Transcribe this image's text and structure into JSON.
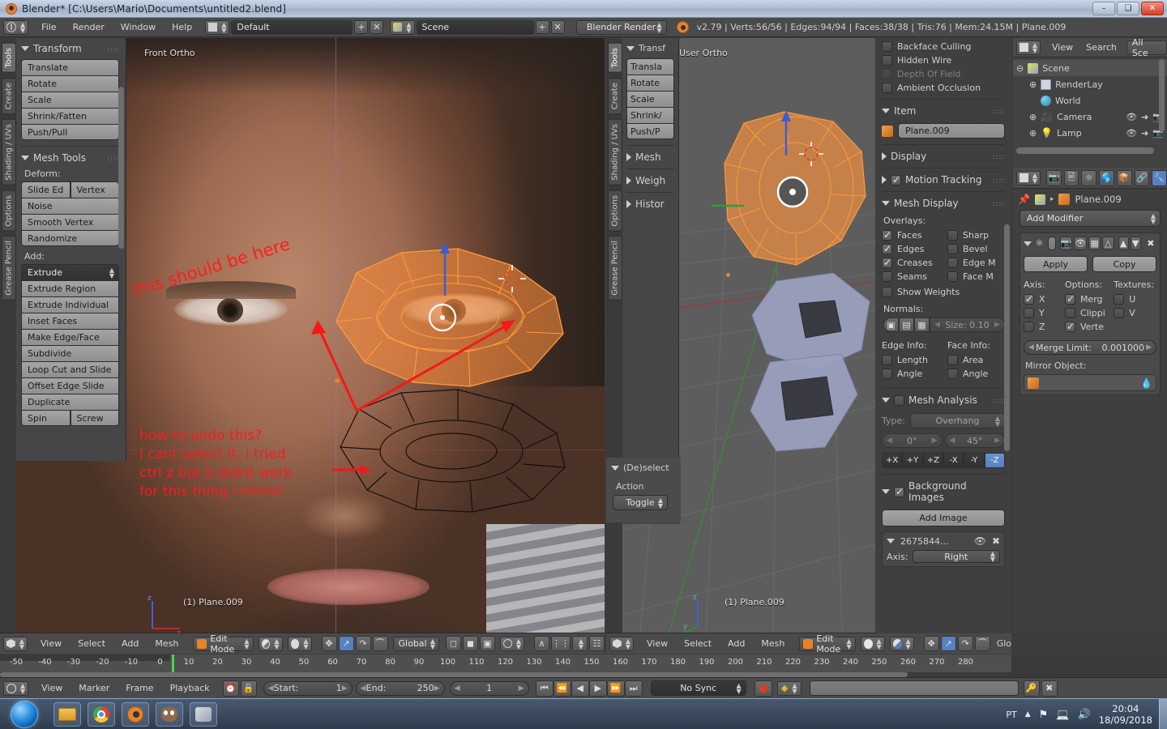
{
  "window": {
    "title": "Blender* [C:\\Users\\Mario\\Documents\\untitled2.blend]",
    "minimize": "–",
    "maximize": "❑",
    "close": "✕"
  },
  "topbar": {
    "info_icon": "info-icon",
    "menus": [
      "File",
      "Render",
      "Window",
      "Help"
    ],
    "screen_layout": "Default",
    "add_layout": "+",
    "remove_layout": "✕",
    "scene": "Scene",
    "add_scene": "+",
    "remove_scene": "✕",
    "engine": "Blender Render",
    "stats": "v2.79 | Verts:56/56 | Edges:94/94 | Faces:38/38 | Tris:76 | Mem:24.15M | Plane.009"
  },
  "viewport_left": {
    "view_label": "Front Ortho",
    "object_label": "(1) Plane.009",
    "vtabs": [
      "Tools",
      "Create",
      "Shading / UVs",
      "Options",
      "Grease Pencil"
    ],
    "active_vtab": "Tools",
    "transform": {
      "title": "Transform",
      "buttons": [
        "Translate",
        "Rotate",
        "Scale",
        "Shrink/Fatten",
        "Push/Pull"
      ]
    },
    "mesh_tools": {
      "title": "Mesh Tools",
      "deform_label": "Deform:",
      "deform_row": [
        "Slide Ed",
        "Vertex"
      ],
      "deform_buttons": [
        "Noise",
        "Smooth Vertex",
        "Randomize"
      ],
      "add_label": "Add:",
      "add_dropdown": "Extrude",
      "add_buttons": [
        "Extrude Region",
        "Extrude Individual",
        "Inset Faces",
        "Make Edge/Face",
        "Subdivide",
        "Loop Cut and Slide",
        "Offset Edge Slide",
        "Duplicate"
      ],
      "last_row": [
        "Spin",
        "Screw"
      ]
    },
    "header": {
      "editor_icon": "editor-type-icon",
      "menus": [
        "View",
        "Select",
        "Add",
        "Mesh"
      ],
      "mode": "Edit Mode",
      "mode_icon": "edit-mode-icon",
      "shading_icon": "viewport-shading-icon",
      "select_modes": [
        "vertex-select-icon",
        "edge-select-icon",
        "face-select-icon"
      ],
      "pivot_icon": "pivot-point-icon",
      "manipulator_icons": [
        "translate-manipulator-icon",
        "rotate-manipulator-icon",
        "scale-manipulator-icon"
      ],
      "orientation": "Global",
      "layer_icons": [
        "limit-to-visible-icon",
        "xray-icon",
        "occlude-icon"
      ],
      "proportional_icon": "proportional-editing-icon",
      "snap_icon": "snap-magnet-icon",
      "snap_target_icon": "snap-target-icon",
      "pivot_center_icon": "pivot-center-icon"
    },
    "annotations": {
      "one": "this should be here",
      "two": "how to undo this?\ni cant select it, i tried\nctrl z but it didnt work\nfor this thing i mirror"
    }
  },
  "viewport_right": {
    "view_label": "User Ortho",
    "object_label": "(1) Plane.009",
    "vtabs": [
      "Tools",
      "Create",
      "Shading / UVs",
      "Options",
      "Grease Pencil"
    ],
    "transform": {
      "title": "Transf",
      "buttons": [
        "Transla",
        "Rotate",
        "Scale",
        "Shrink/",
        "Push/P"
      ]
    },
    "collapsed_panels": [
      "Mesh",
      "Weigh",
      "Histor"
    ],
    "deselect_panel": {
      "title": "(De)select",
      "action_label": "Action",
      "action_value": "Toggle"
    },
    "header": {
      "menus": [
        "View",
        "Select",
        "Add",
        "Mesh"
      ],
      "mode": "Edit Mode",
      "orientation": "Glo"
    }
  },
  "npanel": {
    "display_checks": [
      {
        "label": "Backface Culling",
        "checked": false,
        "disabled": false
      },
      {
        "label": "Hidden Wire",
        "checked": false,
        "disabled": false
      },
      {
        "label": "Depth Of Field",
        "checked": false,
        "disabled": true
      },
      {
        "label": "Ambient Occlusion",
        "checked": false,
        "disabled": false
      }
    ],
    "item": {
      "title": "Item",
      "object_icon": "object-data-icon",
      "name": "Plane.009"
    },
    "display": {
      "title": "Display"
    },
    "motion_tracking": {
      "title": "Motion Tracking",
      "checked": true
    },
    "mesh_display": {
      "title": "Mesh Display",
      "overlays_label": "Overlays:",
      "left_column": [
        {
          "label": "Faces",
          "checked": true
        },
        {
          "label": "Edges",
          "checked": true
        },
        {
          "label": "Creases",
          "checked": true
        },
        {
          "label": "Seams",
          "checked": false
        },
        {
          "label": "Show Weights",
          "checked": false
        }
      ],
      "right_column": [
        {
          "label": "Sharp",
          "checked": false
        },
        {
          "label": "Bevel",
          "checked": false
        },
        {
          "label": "Edge M",
          "checked": false
        },
        {
          "label": "Face M",
          "checked": false
        }
      ],
      "normals_label": "Normals:",
      "normals_icons": [
        "vertex-normal-icon",
        "split-normal-icon",
        "face-normal-icon"
      ],
      "normals_size": "Size: 0.10",
      "edge_info_label": "Edge Info:",
      "face_info_label": "Face Info:",
      "edge_info": [
        {
          "label": "Length",
          "checked": false
        },
        {
          "label": "Angle",
          "checked": false
        }
      ],
      "face_info": [
        {
          "label": "Area",
          "checked": false
        },
        {
          "label": "Angle",
          "checked": false
        }
      ]
    },
    "mesh_analysis": {
      "title": "Mesh Analysis",
      "checked": false,
      "type_label": "Type:",
      "type_value": "Overhang",
      "min_angle": "0°",
      "max_angle": "45°",
      "axes": [
        "+X",
        "+Y",
        "+Z",
        "-X",
        "-Y",
        "-Z"
      ],
      "active_axis": "-Z"
    },
    "background_images": {
      "title": "Background Images",
      "checked": true,
      "add_button": "Add Image",
      "image_name": "2675844...",
      "eye_icon": "visibility-eye-icon",
      "close_icon": "remove-x-icon",
      "axis_label": "Axis:",
      "axis_value": "Right"
    }
  },
  "outliner": {
    "editor_icon": "outliner-editor-icon",
    "menus": [
      "View",
      "Search"
    ],
    "display_mode": "All Sce",
    "rows": [
      {
        "label": "Scene",
        "icon": "scene-icon",
        "indent": 0,
        "expander": "⊖"
      },
      {
        "label": "RenderLay",
        "icon": "renderlayer-icon",
        "indent": 1,
        "expander": "⊕"
      },
      {
        "label": "World",
        "icon": "world-icon",
        "indent": 1,
        "expander": ""
      },
      {
        "label": "Camera",
        "icon": "camera-icon",
        "indent": 1,
        "expander": "⊕"
      },
      {
        "label": "Lamp",
        "icon": "lamp-icon",
        "indent": 1,
        "expander": "⊕"
      }
    ]
  },
  "properties": {
    "editor_icon": "properties-editor-icon",
    "tabs": [
      "render-tab-icon",
      "renderlayers-tab-icon",
      "scene-tab-icon",
      "world-tab-icon",
      "object-tab-icon",
      "constraints-tab-icon",
      "modifiers-tab-icon"
    ],
    "active_tab": "modifiers-tab-icon",
    "breadcrumb": {
      "pin_icon": "pin-icon",
      "scene_icon": "scene-icon",
      "separator": "▸",
      "object_icon": "object-icon",
      "object_name": "Plane.009"
    },
    "add_modifier": "Add Modifier",
    "modifier_header_icons": [
      "expand-triangle-icon",
      "modifier-mirror-icon",
      "render-toggle-icon",
      "viewport-toggle-icon",
      "edit-mode-toggle-icon",
      "on-cage-toggle-icon",
      "move-up-icon",
      "move-down-icon",
      "delete-x-icon"
    ],
    "apply": "Apply",
    "copy": "Copy",
    "axis_label": "Axis:",
    "options_label": "Options:",
    "textures_label": "Textures:",
    "axis": [
      {
        "label": "X",
        "checked": true
      },
      {
        "label": "Y",
        "checked": false
      },
      {
        "label": "Z",
        "checked": false
      }
    ],
    "options": [
      {
        "label": "Merg",
        "checked": true
      },
      {
        "label": "Clippi",
        "checked": false
      },
      {
        "label": "Verte",
        "checked": true
      }
    ],
    "textures": [
      {
        "label": "U",
        "checked": false
      },
      {
        "label": "V",
        "checked": false
      }
    ],
    "merge_limit_label": "Merge Limit:",
    "merge_limit_value": "0.001000",
    "mirror_object_label": "Mirror Object:",
    "mirror_object_value": "",
    "eyedropper_icon": "eyedropper-icon"
  },
  "timeline": {
    "editor_icon": "timeline-editor-icon",
    "menus": [
      "View",
      "Marker",
      "Frame",
      "Playback"
    ],
    "use_audio_icon": "audio-sync-icon",
    "lock_icon": "lock-icon",
    "start_label": "Start:",
    "start_value": "1",
    "end_label": "End:",
    "end_value": "250",
    "current_frame": "1",
    "transport": [
      "jump-start-icon",
      "prev-keyframe-icon",
      "play-reverse-icon",
      "play-icon",
      "next-keyframe-icon",
      "jump-end-icon"
    ],
    "sync_mode": "No Sync",
    "record_icon": "record-icon",
    "keying_set_icon": "keying-set-icon",
    "keying_field": "",
    "insert_key_icon": "insert-keyframe-icon",
    "delete_key_icon": "delete-keyframe-icon",
    "ruler_ticks": [
      "-50",
      "-40",
      "-30",
      "-20",
      "-10",
      "0",
      "10",
      "20",
      "30",
      "40",
      "50",
      "60",
      "70",
      "80",
      "90",
      "100",
      "110",
      "120",
      "130",
      "140",
      "150",
      "160",
      "170",
      "180",
      "190",
      "200",
      "210",
      "220",
      "230",
      "240",
      "250",
      "260",
      "270",
      "280"
    ]
  },
  "taskbar": {
    "start_icon": "start-orb-icon",
    "apps": [
      "file-explorer-icon",
      "chrome-icon",
      "blender-icon",
      "gimp-icon",
      "other-app-icon"
    ],
    "language": "PT",
    "tray_icons": [
      "show-hidden-icons-icon",
      "flag-action-center-icon",
      "network-icon",
      "volume-icon"
    ],
    "time": "20:04",
    "date": "18/09/2018"
  },
  "colors": {
    "accent_orange": "#e8822a",
    "selection_orange": "#ff9a3c",
    "annotation_red": "#fb1f1f",
    "blue_active": "#5680c2",
    "panel_bg": "#3f3f3f",
    "header_bg": "#4a4a4a"
  }
}
